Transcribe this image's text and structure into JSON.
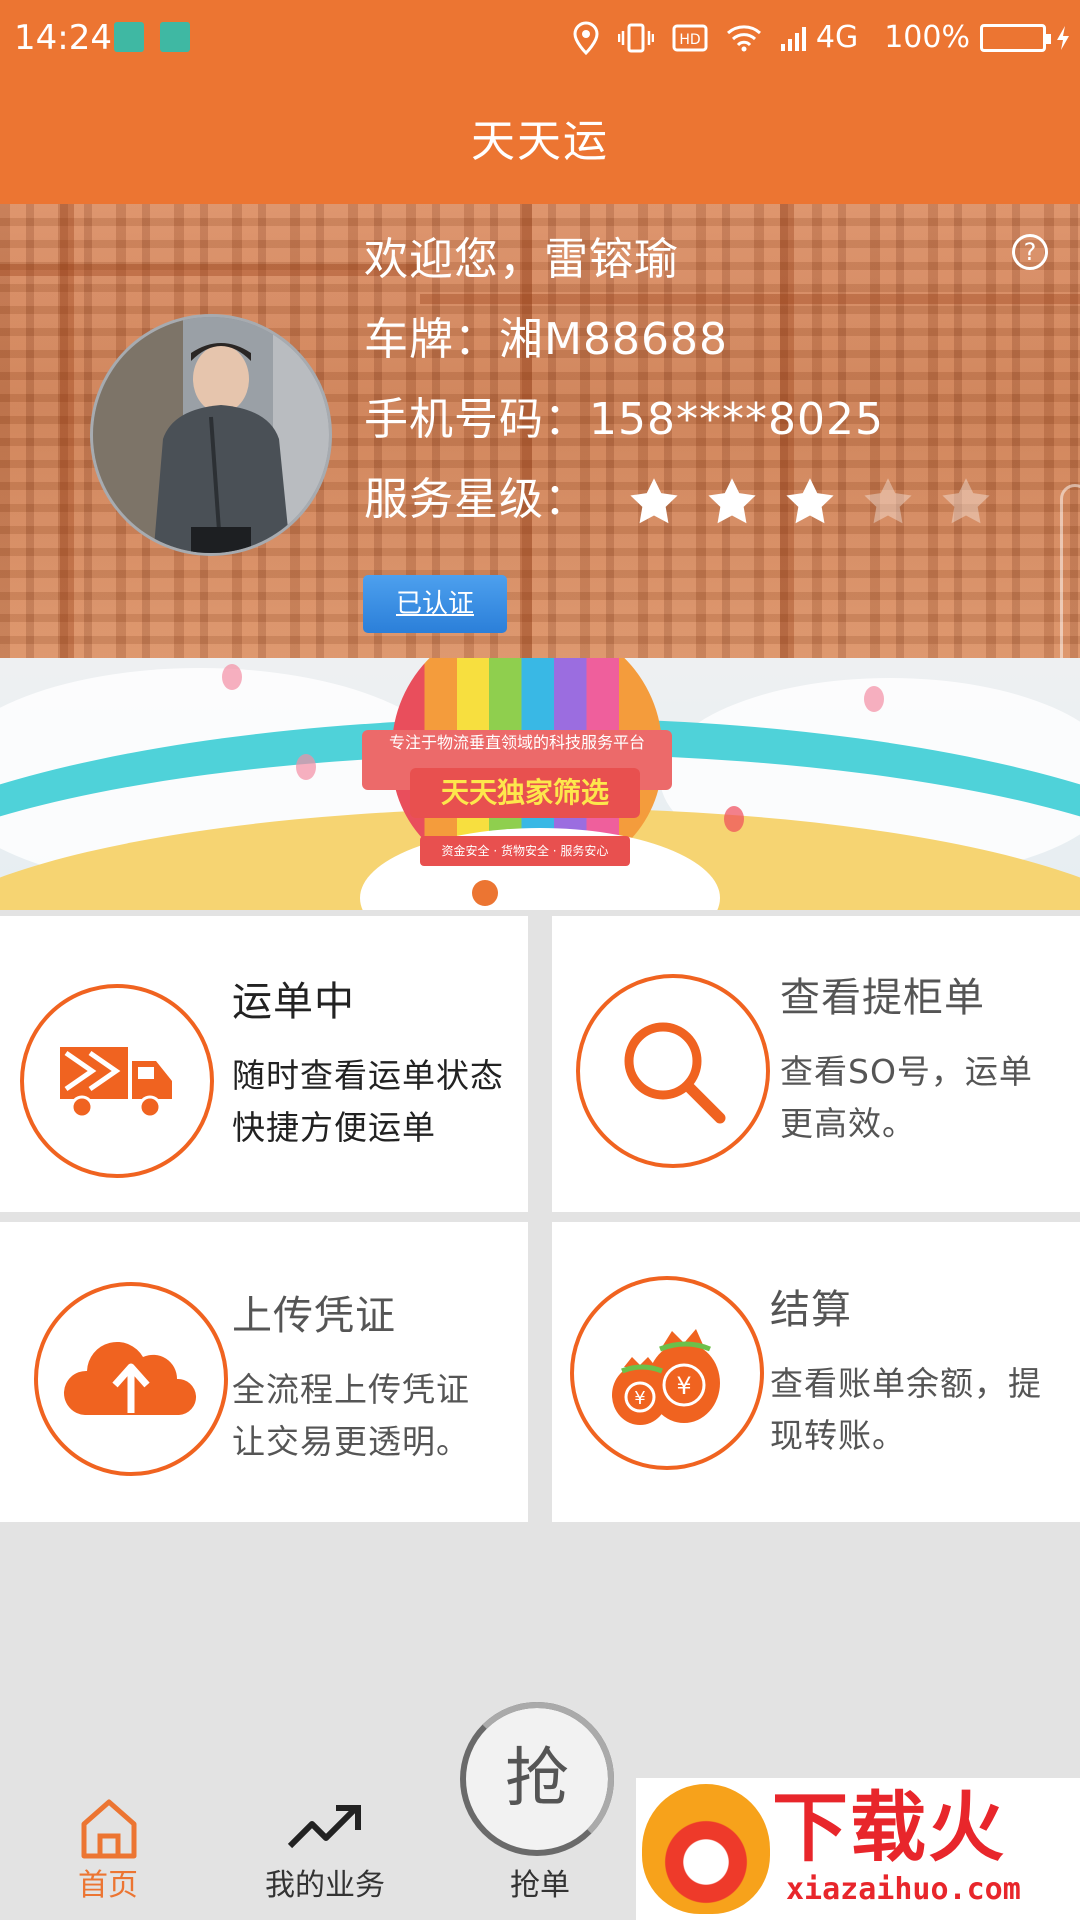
{
  "status_bar": {
    "time": "14:24",
    "network": "4G",
    "battery": "100%",
    "battery_level": 1.0
  },
  "header": {
    "title": "天天运"
  },
  "profile": {
    "welcome": "欢迎您，雷镕瑜",
    "plate": "车牌：湘M88688",
    "phone": "手机号码：158****8025",
    "rating_label": "服务星级：",
    "rating": 3,
    "rating_max": 5,
    "verified_label": "已认证",
    "help_glyph": "?"
  },
  "banner": {
    "tagline": "专注于物流垂直领域的科技服务平台",
    "headline": "天天独家筛选",
    "subline": "资金安全 · 货物安全 · 服务安心",
    "slide_count": 3,
    "active_slide": 1
  },
  "features": [
    {
      "title": "运单中",
      "desc1": "随时查看运单状态",
      "desc2": "快捷方便运单",
      "icon": "truck-icon"
    },
    {
      "title": "查看提柜单",
      "desc1": "查看SO号，运单",
      "desc2": "更高效。",
      "icon": "magnifier-icon"
    },
    {
      "title": "上传凭证",
      "desc1": "全流程上传凭证",
      "desc2": "让交易更透明。",
      "icon": "cloud-upload-icon"
    },
    {
      "title": "结算",
      "desc1": "查看账单余额，提",
      "desc2": "现转账。",
      "icon": "money-bag-icon"
    }
  ],
  "bottom_nav": {
    "home": "首页",
    "business": "我的业务",
    "grab": "抢单",
    "grab_char": "抢"
  },
  "watermark": {
    "title": "下载火",
    "url": "xiazaihuo.com"
  },
  "colors": {
    "brand_orange": "#ec7532",
    "icon_orange": "#f06320",
    "verified_blue": "#2b7fd9",
    "battery_green": "#41d15a"
  }
}
